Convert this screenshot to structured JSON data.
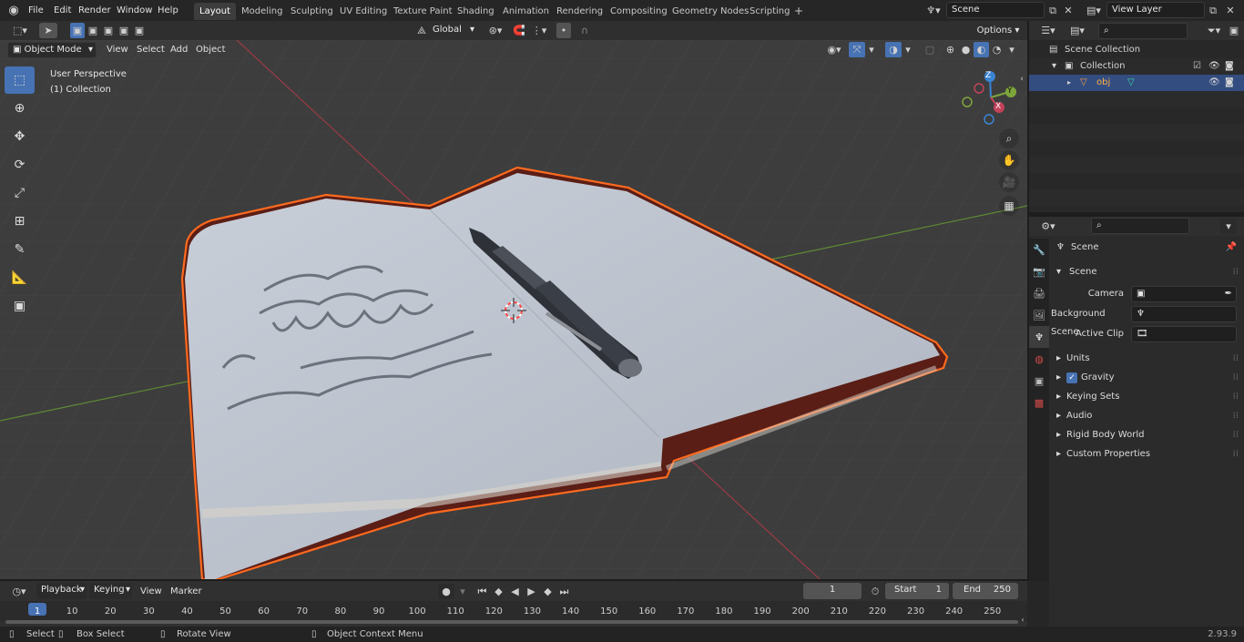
{
  "topbar": {
    "menus": [
      "File",
      "Edit",
      "Render",
      "Window",
      "Help"
    ],
    "workspaces": [
      "Layout",
      "Modeling",
      "Sculpting",
      "UV Editing",
      "Texture Paint",
      "Shading",
      "Animation",
      "Rendering",
      "Compositing",
      "Geometry Nodes",
      "Scripting"
    ],
    "active_workspace": "Layout",
    "add_tab": "+",
    "scene_name": "Scene",
    "view_layer": "View Layer"
  },
  "viewport_header": {
    "mode": "Object Mode",
    "menus": [
      "View",
      "Select",
      "Add",
      "Object"
    ],
    "orientation": "Global",
    "options": "Options"
  },
  "viewport": {
    "perspective_label": "User Perspective",
    "collection_label": "(1) Collection",
    "gizmo": {
      "z": "Z",
      "y": "Y",
      "x": "X"
    }
  },
  "outliner": {
    "root": "Scene Collection",
    "collection": "Collection",
    "object": "obj"
  },
  "properties": {
    "context": "Scene",
    "section": "Scene",
    "fields": [
      {
        "label": "Camera",
        "value": ""
      },
      {
        "label": "Background Scene",
        "value": ""
      },
      {
        "label": "Active Clip",
        "value": ""
      }
    ],
    "panels": [
      "Units",
      "Gravity",
      "Keying Sets",
      "Audio",
      "Rigid Body World",
      "Custom Properties"
    ],
    "gravity_checked": true
  },
  "timeline": {
    "menus": [
      "Playback",
      "Keying",
      "View",
      "Marker"
    ],
    "current_frame": "1",
    "start_label": "Start",
    "start": "1",
    "end_label": "End",
    "end": "250",
    "ticks": [
      "1",
      "10",
      "20",
      "30",
      "40",
      "50",
      "60",
      "70",
      "80",
      "90",
      "100",
      "110",
      "120",
      "130",
      "140",
      "150",
      "160",
      "170",
      "180",
      "190",
      "200",
      "210",
      "220",
      "230",
      "240",
      "250"
    ]
  },
  "statusbar": {
    "select": "Select",
    "box_select": "Box Select",
    "rotate_view": "Rotate View",
    "context_menu": "Object Context Menu",
    "version": "2.93.9"
  },
  "colors": {
    "accent": "#4772b3",
    "selection_outline": "#ff6a1f",
    "x_axis": "#c2425a",
    "y_axis": "#7ea53a",
    "z_axis": "#3a84d4"
  }
}
